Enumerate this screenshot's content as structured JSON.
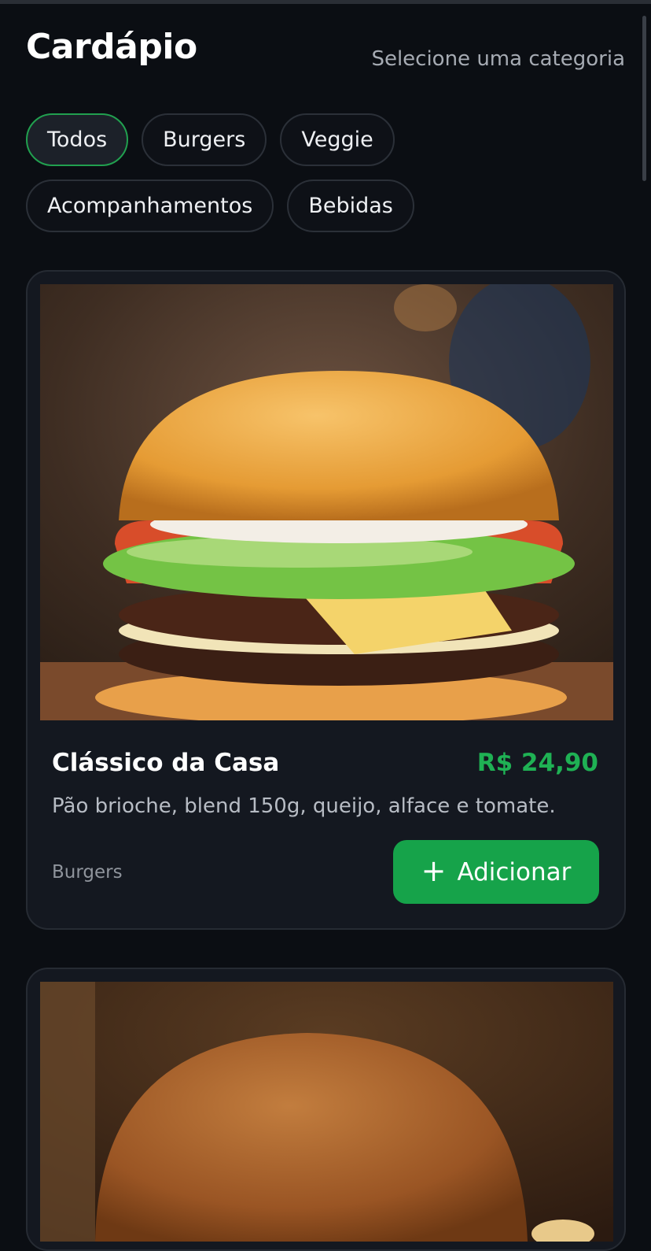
{
  "header": {
    "title": "Cardápio",
    "subtitle": "Selecione uma categoria"
  },
  "categories": [
    {
      "label": "Todos",
      "active": true
    },
    {
      "label": "Burgers",
      "active": false
    },
    {
      "label": "Veggie",
      "active": false
    },
    {
      "label": "Acompanhamentos",
      "active": false
    },
    {
      "label": "Bebidas",
      "active": false
    }
  ],
  "products": [
    {
      "name": "Clássico da Casa",
      "price": "R$ 24,90",
      "description": "Pão brioche, blend 150g, queijo, alface e tomate.",
      "category": "Burgers",
      "add_label": "Adicionar",
      "add_icon": "plus-icon"
    }
  ],
  "colors": {
    "background": "#0b0e13",
    "card": "#141820",
    "accent_green": "#16a34a",
    "price_green": "#1fb154",
    "active_chip_border": "#21a04f"
  }
}
